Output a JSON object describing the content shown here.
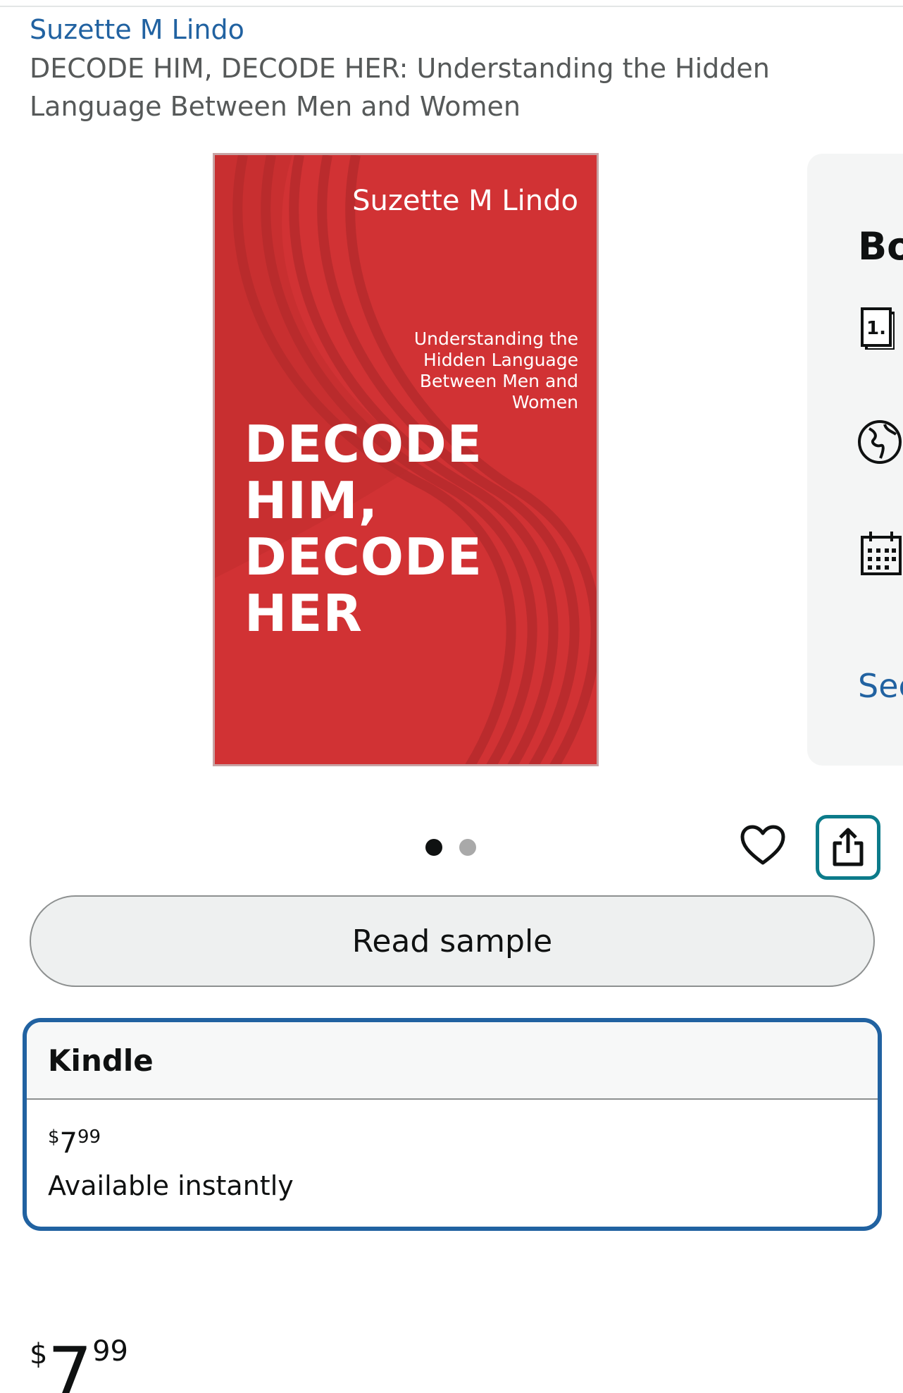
{
  "header": {
    "author": "Suzette M Lindo",
    "title": "DECODE HIM, DECODE HER: Understanding the Hidden Language Between Men and Women"
  },
  "cover": {
    "author": "Suzette M Lindo",
    "subtitle": "Understanding the Hidden Language Between Men and Women",
    "title_lines": [
      "DECODE",
      "HIM,",
      "DECODE",
      "HER"
    ],
    "background_color": "#d13234"
  },
  "details_card": {
    "heading": "Bo",
    "icons": [
      "print-length-icon",
      "language-globe-icon",
      "calendar-icon"
    ],
    "see_label": "See"
  },
  "carousel": {
    "count": 2,
    "active_index": 0
  },
  "actions": {
    "wishlist_icon": "heart-icon",
    "share_icon": "share-icon",
    "read_sample_label": "Read sample"
  },
  "format": {
    "name": "Kindle",
    "price_symbol": "$",
    "price_whole": "7",
    "price_fraction": "99",
    "availability": "Available instantly"
  },
  "price": {
    "symbol": "$",
    "whole": "7",
    "fraction": "99"
  },
  "colors": {
    "link": "#2162a1",
    "selected_border": "#2162a1",
    "share_border": "#0c7b8a",
    "cover_red": "#d13234"
  }
}
